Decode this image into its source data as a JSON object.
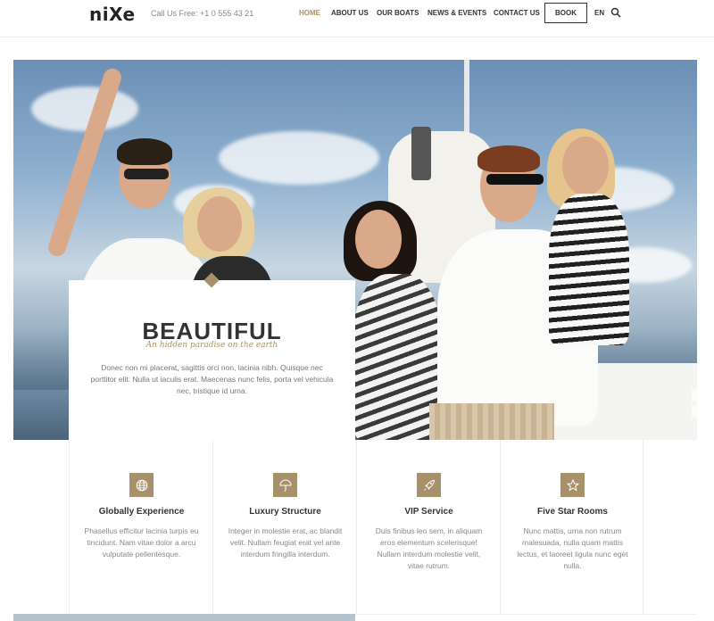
{
  "header": {
    "logo": "niXe",
    "phone": "Call Us Free: +1 0 555 43 21",
    "nav": [
      "HOME",
      "ABOUT US",
      "OUR BOATS",
      "NEWS & EVENTS",
      "CONTACT US"
    ],
    "book_label": "BOOK",
    "lang": "EN",
    "search_icon": "search-icon"
  },
  "hero": {
    "title": "BEAUTIFUL",
    "subtitle": "An hidden paradise on the earth",
    "text": "Donec non mi placerat, sagittis orci non, lacinia nibh. Quisque nec porttitor elit. Nulla ut iaculis erat. Maecenas nunc felis, porta vel vehicula nec, tristique id urna."
  },
  "features": [
    {
      "icon": "globe-icon",
      "title": "Globally Experience",
      "text": "Phasellus efficitur lacinia turpis eu tincidunt. Nam vitae dolor a arcu vulputate pellentesque."
    },
    {
      "icon": "umbrella-icon",
      "title": "Luxury Structure",
      "text": "Integer in molestie erat, ac blandit velit. Nullam feugiat erat vel ante interdum fringilla interdum."
    },
    {
      "icon": "rocket-icon",
      "title": "VIP Service",
      "text": "Duis finibus leo sem, in aliquam eros elementum scelerisque! Nullam interdum molestie velit, vitae rutrum."
    },
    {
      "icon": "star-icon",
      "title": "Five Star Rooms",
      "text": "Nunc mattis, urna non rutrum malesuada, nulla quam mattis lectus, et laoreet ligula nunc eget nulla."
    }
  ],
  "colors": {
    "accent": "#a8916a",
    "text": "#333333",
    "muted": "#888888"
  }
}
